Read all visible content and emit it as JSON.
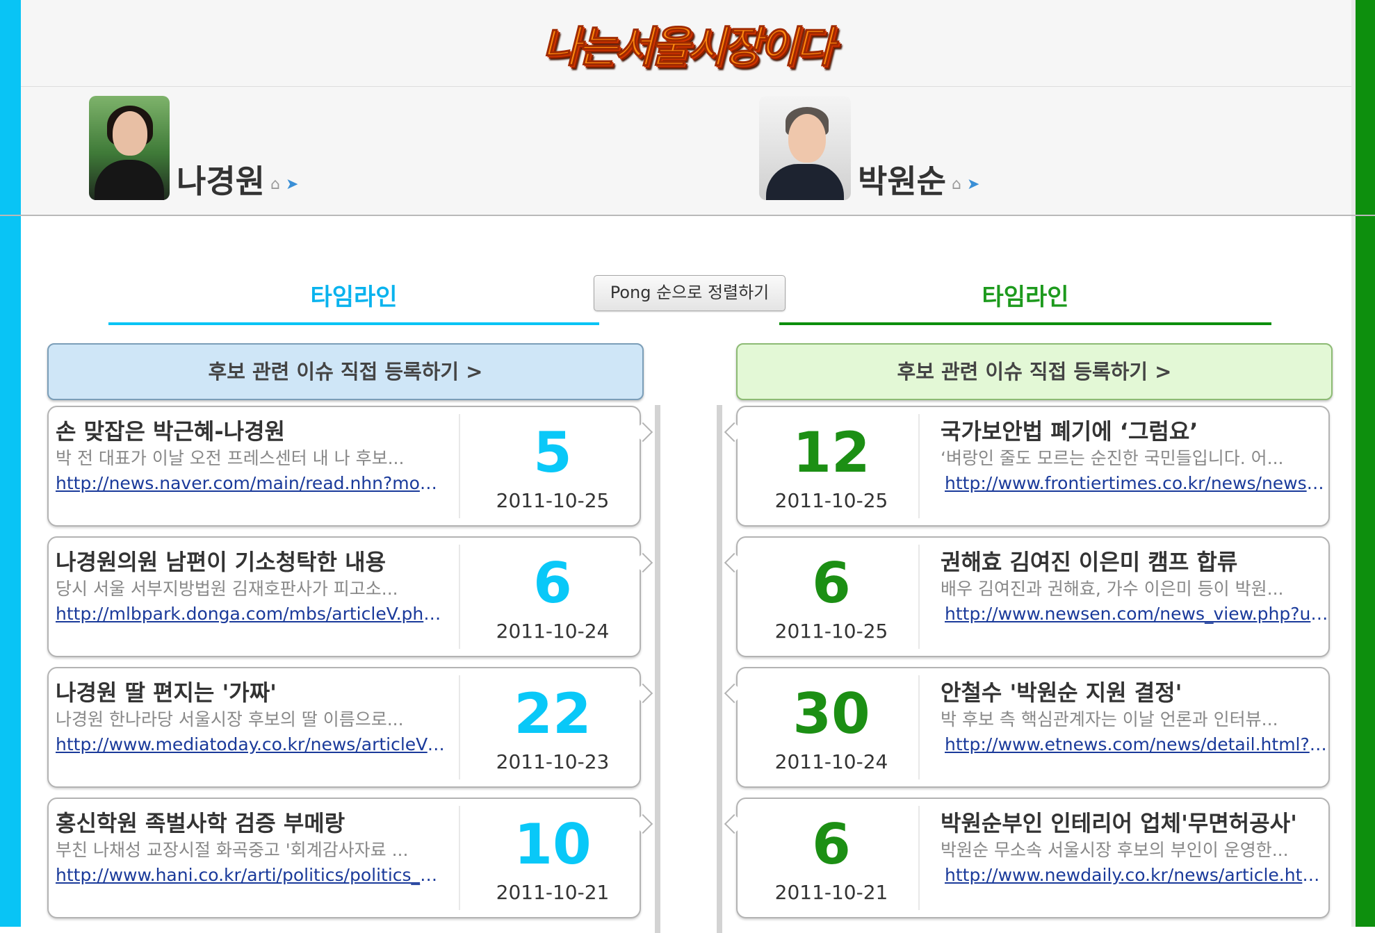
{
  "header": {
    "logo_text": "나는서울시장이다"
  },
  "candidates": {
    "left": {
      "name": "나경원",
      "home_icon": "home-icon",
      "twitter_icon": "twitter-bird-icon"
    },
    "right": {
      "name": "박원순",
      "home_icon": "home-icon",
      "twitter_icon": "twitter-bird-icon"
    }
  },
  "tabs": {
    "left_label": "타임라인",
    "right_label": "타임라인"
  },
  "sort_button": "Pong 순으로 정렬하기",
  "register": {
    "left_label": "후보 관련 이슈 직접 등록하기   >",
    "right_label": "후보 관련 이슈 직접 등록하기   >"
  },
  "colors": {
    "left_accent": "#09c4f5",
    "right_accent": "#0d8f0d"
  },
  "left_items": [
    {
      "title": "손 맞잡은 박근혜-나경원",
      "desc": "박 전 대표가 이날 오전 프레스센터 내 나 후보...",
      "link": "http://news.naver.com/main/read.nhn?mod...",
      "count": "5",
      "date": "2011-10-25"
    },
    {
      "title": "나경원의원 남편이 기소청탁한 내용",
      "desc": "당시 서울 서부지방법원 김재호판사가 피고소...",
      "link": "http://mlbpark.donga.com/mbs/articleV.php...",
      "count": "6",
      "date": "2011-10-24"
    },
    {
      "title": "나경원 딸 편지는 '가짜'",
      "desc": "나경원 한나라당 서울시장 후보의 딸 이름으로...",
      "link": "http://www.mediatoday.co.kr/news/articleVi...",
      "count": "22",
      "date": "2011-10-23"
    },
    {
      "title": "홍신학원 족벌사학 검증 부메랑",
      "desc": "부친 나채성 교장시절 화곡중고 '회계감사자료 ...",
      "link": "http://www.hani.co.kr/arti/politics/politics_g...",
      "count": "10",
      "date": "2011-10-21"
    }
  ],
  "right_items": [
    {
      "title": "국가보안법 폐기에 ‘그럼요’",
      "desc": "‘벼랑인 줄도 모르는 순진한 국민들입니다. 어...",
      "link": "http://www.frontiertimes.co.kr/news/news/2...",
      "count": "12",
      "date": "2011-10-25"
    },
    {
      "title": "권해효 김여진 이은미 캠프 합류",
      "desc": "배우 김여진과 권해효, 가수 이은미 등이 박원...",
      "link": "http://www.newsen.com/news_view.php?ui...",
      "count": "6",
      "date": "2011-10-25"
    },
    {
      "title": "안철수 '박원순 지원 결정'",
      "desc": "박 후보 측 핵심관계자는 이날 언론과 인터뷰...",
      "link": "http://www.etnews.com/news/detail.html?id...",
      "count": "30",
      "date": "2011-10-24"
    },
    {
      "title": "박원순부인 인테리어 업체'무면허공사'",
      "desc": "박원순 무소속 서울시장 후보의 부인이 운영한...",
      "link": "http://www.newdaily.co.kr/news/article.html...",
      "count": "6",
      "date": "2011-10-21"
    }
  ]
}
